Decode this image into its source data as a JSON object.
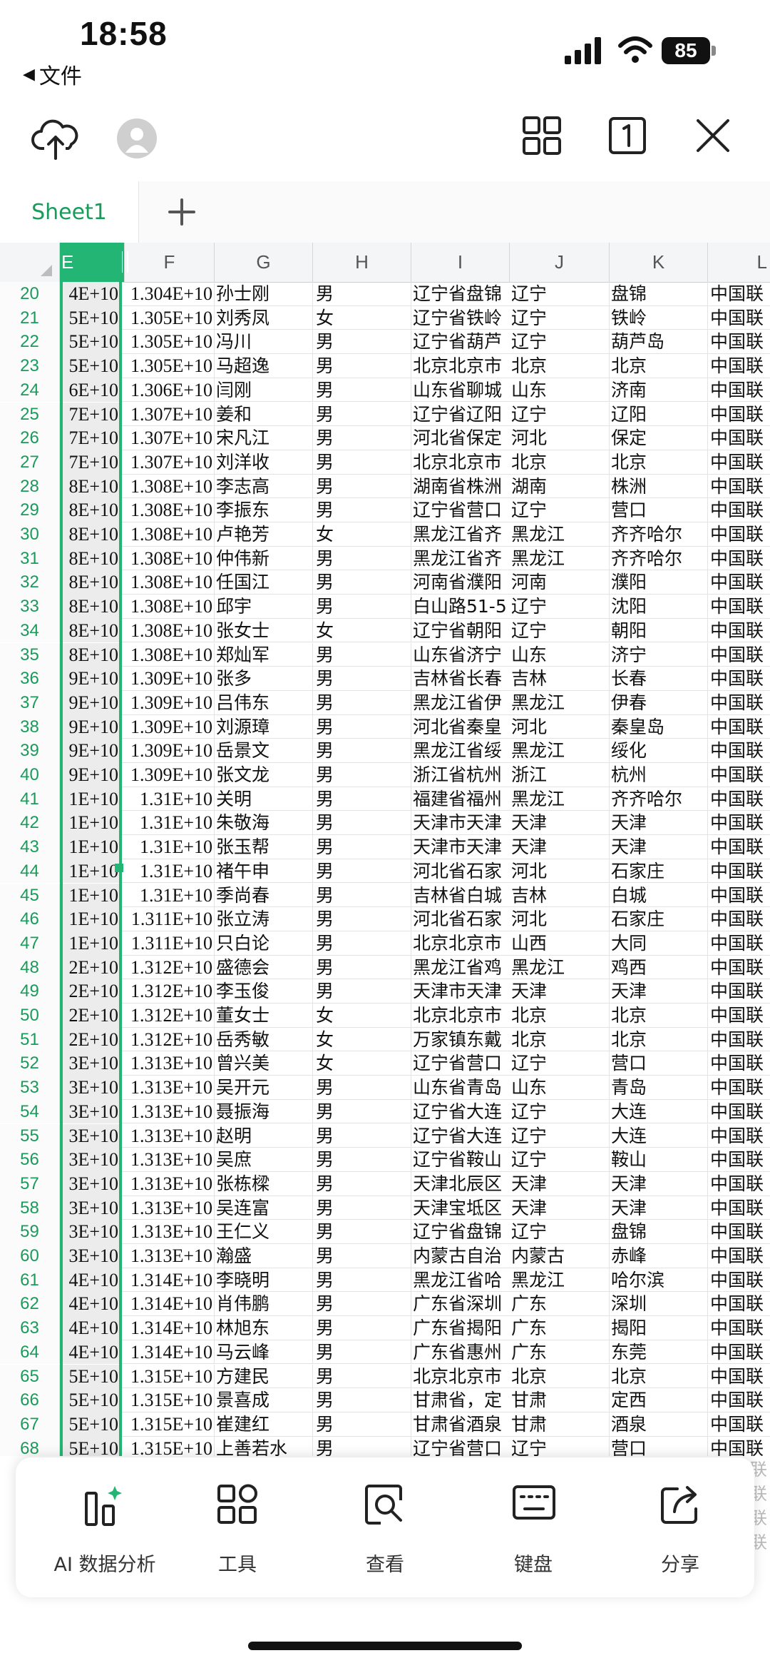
{
  "status_bar": {
    "time": "18:58",
    "back_app": "文件",
    "battery": "85"
  },
  "sheet_tabs": {
    "active": "Sheet1",
    "add": "+"
  },
  "columns": [
    "E",
    "F",
    "G",
    "H",
    "I",
    "J",
    "K",
    "L"
  ],
  "rows": [
    [
      "20",
      "4E+10",
      "1.304E+10",
      "孙士刚",
      "男",
      "辽宁省盘锦",
      "辽宁",
      "盘锦",
      "中国联"
    ],
    [
      "21",
      "5E+10",
      "1.305E+10",
      "刘秀凤",
      "女",
      "辽宁省铁岭",
      "辽宁",
      "铁岭",
      "中国联"
    ],
    [
      "22",
      "5E+10",
      "1.305E+10",
      "冯川",
      "男",
      "辽宁省葫芦",
      "辽宁",
      "葫芦岛",
      "中国联"
    ],
    [
      "23",
      "5E+10",
      "1.305E+10",
      "马超逸",
      "男",
      "北京北京市",
      "北京",
      "北京",
      "中国联"
    ],
    [
      "24",
      "6E+10",
      "1.306E+10",
      "闫刚",
      "男",
      "山东省聊城",
      "山东",
      "济南",
      "中国联"
    ],
    [
      "25",
      "7E+10",
      "1.307E+10",
      "姜和",
      "男",
      "辽宁省辽阳",
      "辽宁",
      "辽阳",
      "中国联"
    ],
    [
      "26",
      "7E+10",
      "1.307E+10",
      "宋凡江",
      "男",
      "河北省保定",
      "河北",
      "保定",
      "中国联"
    ],
    [
      "27",
      "7E+10",
      "1.307E+10",
      "刘洋收",
      "男",
      "北京北京市",
      "北京",
      "北京",
      "中国联"
    ],
    [
      "28",
      "8E+10",
      "1.308E+10",
      "李志高",
      "男",
      "湖南省株洲",
      "湖南",
      "株洲",
      "中国联"
    ],
    [
      "29",
      "8E+10",
      "1.308E+10",
      "李振东",
      "男",
      "辽宁省营口",
      "辽宁",
      "营口",
      "中国联"
    ],
    [
      "30",
      "8E+10",
      "1.308E+10",
      "卢艳芳",
      "女",
      "黑龙江省齐",
      "黑龙江",
      "齐齐哈尔",
      "中国联"
    ],
    [
      "31",
      "8E+10",
      "1.308E+10",
      "仲伟新",
      "男",
      "黑龙江省齐",
      "黑龙江",
      "齐齐哈尔",
      "中国联"
    ],
    [
      "32",
      "8E+10",
      "1.308E+10",
      "任国江",
      "男",
      "河南省濮阳",
      "河南",
      "濮阳",
      "中国联"
    ],
    [
      "33",
      "8E+10",
      "1.308E+10",
      "邱宇",
      "男",
      "白山路51-5",
      "辽宁",
      "沈阳",
      "中国联"
    ],
    [
      "34",
      "8E+10",
      "1.308E+10",
      "张女士",
      "女",
      "辽宁省朝阳",
      "辽宁",
      "朝阳",
      "中国联"
    ],
    [
      "35",
      "8E+10",
      "1.308E+10",
      "郑灿军",
      "男",
      "山东省济宁",
      "山东",
      "济宁",
      "中国联"
    ],
    [
      "36",
      "9E+10",
      "1.309E+10",
      "张多",
      "男",
      "吉林省长春",
      "吉林",
      "长春",
      "中国联"
    ],
    [
      "37",
      "9E+10",
      "1.309E+10",
      "吕伟东",
      "男",
      "黑龙江省伊",
      "黑龙江",
      "伊春",
      "中国联"
    ],
    [
      "38",
      "9E+10",
      "1.309E+10",
      "刘源璋",
      "男",
      "河北省秦皇",
      "河北",
      "秦皇岛",
      "中国联"
    ],
    [
      "39",
      "9E+10",
      "1.309E+10",
      "岳景文",
      "男",
      "黑龙江省绥",
      "黑龙江",
      "绥化",
      "中国联"
    ],
    [
      "40",
      "9E+10",
      "1.309E+10",
      "张文龙",
      "男",
      "浙江省杭州",
      "浙江",
      "杭州",
      "中国联"
    ],
    [
      "41",
      "1E+10",
      "1.31E+10",
      "关明",
      "男",
      "福建省福州",
      "黑龙江",
      "齐齐哈尔",
      "中国联"
    ],
    [
      "42",
      "1E+10",
      "1.31E+10",
      "朱敬海",
      "男",
      "天津市天津",
      "天津",
      "天津",
      "中国联"
    ],
    [
      "43",
      "1E+10",
      "1.31E+10",
      "张玉帮",
      "男",
      "天津市天津",
      "天津",
      "天津",
      "中国联"
    ],
    [
      "44",
      "1E+10",
      "1.31E+10",
      "褚午申",
      "男",
      "河北省石家",
      "河北",
      "石家庄",
      "中国联"
    ],
    [
      "45",
      "1E+10",
      "1.31E+10",
      "季尚春",
      "男",
      "吉林省白城",
      "吉林",
      "白城",
      "中国联"
    ],
    [
      "46",
      "1E+10",
      "1.311E+10",
      "张立涛",
      "男",
      "河北省石家",
      "河北",
      "石家庄",
      "中国联"
    ],
    [
      "47",
      "1E+10",
      "1.311E+10",
      "只白论",
      "男",
      "北京北京市",
      "山西",
      "大同",
      "中国联"
    ],
    [
      "48",
      "2E+10",
      "1.312E+10",
      "盛德会",
      "男",
      "黑龙江省鸡",
      "黑龙江",
      "鸡西",
      "中国联"
    ],
    [
      "49",
      "2E+10",
      "1.312E+10",
      "李玉俊",
      "男",
      "天津市天津",
      "天津",
      "天津",
      "中国联"
    ],
    [
      "50",
      "2E+10",
      "1.312E+10",
      "董女士",
      "女",
      "北京北京市",
      "北京",
      "北京",
      "中国联"
    ],
    [
      "51",
      "2E+10",
      "1.312E+10",
      "岳秀敏",
      "女",
      "万家镇东戴",
      "北京",
      "北京",
      "中国联"
    ],
    [
      "52",
      "3E+10",
      "1.313E+10",
      "曾兴美",
      "女",
      "辽宁省营口",
      "辽宁",
      "营口",
      "中国联"
    ],
    [
      "53",
      "3E+10",
      "1.313E+10",
      "吴开元",
      "男",
      "山东省青岛",
      "山东",
      "青岛",
      "中国联"
    ],
    [
      "54",
      "3E+10",
      "1.313E+10",
      "聂振海",
      "男",
      "辽宁省大连",
      "辽宁",
      "大连",
      "中国联"
    ],
    [
      "55",
      "3E+10",
      "1.313E+10",
      "赵明",
      "男",
      "辽宁省大连",
      "辽宁",
      "大连",
      "中国联"
    ],
    [
      "56",
      "3E+10",
      "1.313E+10",
      "吴庶",
      "男",
      "辽宁省鞍山",
      "辽宁",
      "鞍山",
      "中国联"
    ],
    [
      "57",
      "3E+10",
      "1.313E+10",
      "张栋樑",
      "男",
      "天津北辰区",
      "天津",
      "天津",
      "中国联"
    ],
    [
      "58",
      "3E+10",
      "1.313E+10",
      "吴连富",
      "男",
      "天津宝坻区",
      "天津",
      "天津",
      "中国联"
    ],
    [
      "59",
      "3E+10",
      "1.313E+10",
      "王仁义",
      "男",
      "辽宁省盘锦",
      "辽宁",
      "盘锦",
      "中国联"
    ],
    [
      "60",
      "3E+10",
      "1.313E+10",
      "瀚盛",
      "男",
      "内蒙古自治",
      "内蒙古",
      "赤峰",
      "中国联"
    ],
    [
      "61",
      "4E+10",
      "1.314E+10",
      "李晓明",
      "男",
      "黑龙江省哈",
      "黑龙江",
      "哈尔滨",
      "中国联"
    ],
    [
      "62",
      "4E+10",
      "1.314E+10",
      "肖伟鹏",
      "男",
      "广东省深圳",
      "广东",
      "深圳",
      "中国联"
    ],
    [
      "63",
      "4E+10",
      "1.314E+10",
      "林旭东",
      "男",
      "广东省揭阳",
      "广东",
      "揭阳",
      "中国联"
    ],
    [
      "64",
      "4E+10",
      "1.314E+10",
      "马云峰",
      "男",
      "广东省惠州",
      "广东",
      "东莞",
      "中国联"
    ],
    [
      "65",
      "5E+10",
      "1.315E+10",
      "方建民",
      "男",
      "北京北京市",
      "北京",
      "北京",
      "中国联"
    ],
    [
      "66",
      "5E+10",
      "1.315E+10",
      "景喜成",
      "男",
      "甘肃省，定",
      "甘肃",
      "定西",
      "中国联"
    ],
    [
      "67",
      "5E+10",
      "1.315E+10",
      "崔建红",
      "男",
      "甘肃省酒泉",
      "甘肃",
      "酒泉",
      "中国联"
    ],
    [
      "68",
      "5E+10",
      "1.315E+10",
      "上善若水",
      "男",
      "辽宁省营口",
      "辽宁",
      "营口",
      "中国联"
    ]
  ],
  "bottom_bar": {
    "ai": "AI 数据分析",
    "tools": "工具",
    "view": "查看",
    "keyboard": "键盘",
    "share": "分享"
  },
  "behind_text": "联",
  "colors": {
    "accent": "#22b573",
    "tab_text": "#1a9b5b"
  }
}
